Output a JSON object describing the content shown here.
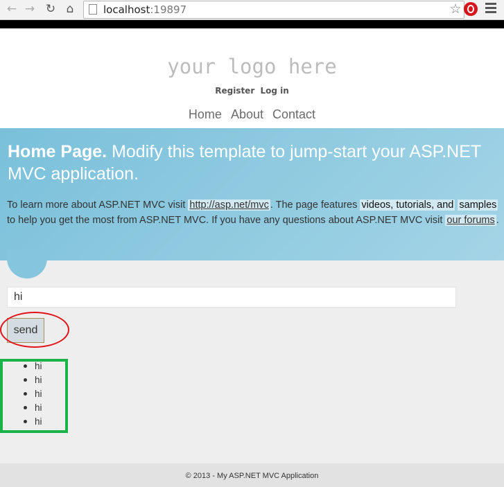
{
  "browser": {
    "url_host": "localhost",
    "url_port": ":19897"
  },
  "header": {
    "logo": "your logo here",
    "register": "Register",
    "login": "Log in",
    "nav": [
      "Home",
      "About",
      "Contact"
    ]
  },
  "featured": {
    "title_bold": "Home Page.",
    "title_rest": "Modify this template to jump-start your ASP.NET MVC application.",
    "p_1": "To learn more about ASP.NET MVC visit",
    "link_mvc": "http://asp.net/mvc",
    "p_2": ". The page features",
    "hl_1": "videos, tutorials, and",
    "hl_2": "samples",
    "p_3": "to help you get the most from ASP.NET MVC. If you have any questions about ASP.NET MVC visit",
    "link_forums": "our forums",
    "p_4": "."
  },
  "chat": {
    "input_value": "hi",
    "send_label": "send",
    "messages": [
      "hi",
      "hi",
      "hi",
      "hi",
      "hi"
    ]
  },
  "footer": {
    "text": "© 2013 - My ASP.NET MVC Application"
  },
  "colors": {
    "featured_bg": "#7ac0da",
    "annotation_red": "#e1141c",
    "annotation_green": "#1ab34a"
  }
}
